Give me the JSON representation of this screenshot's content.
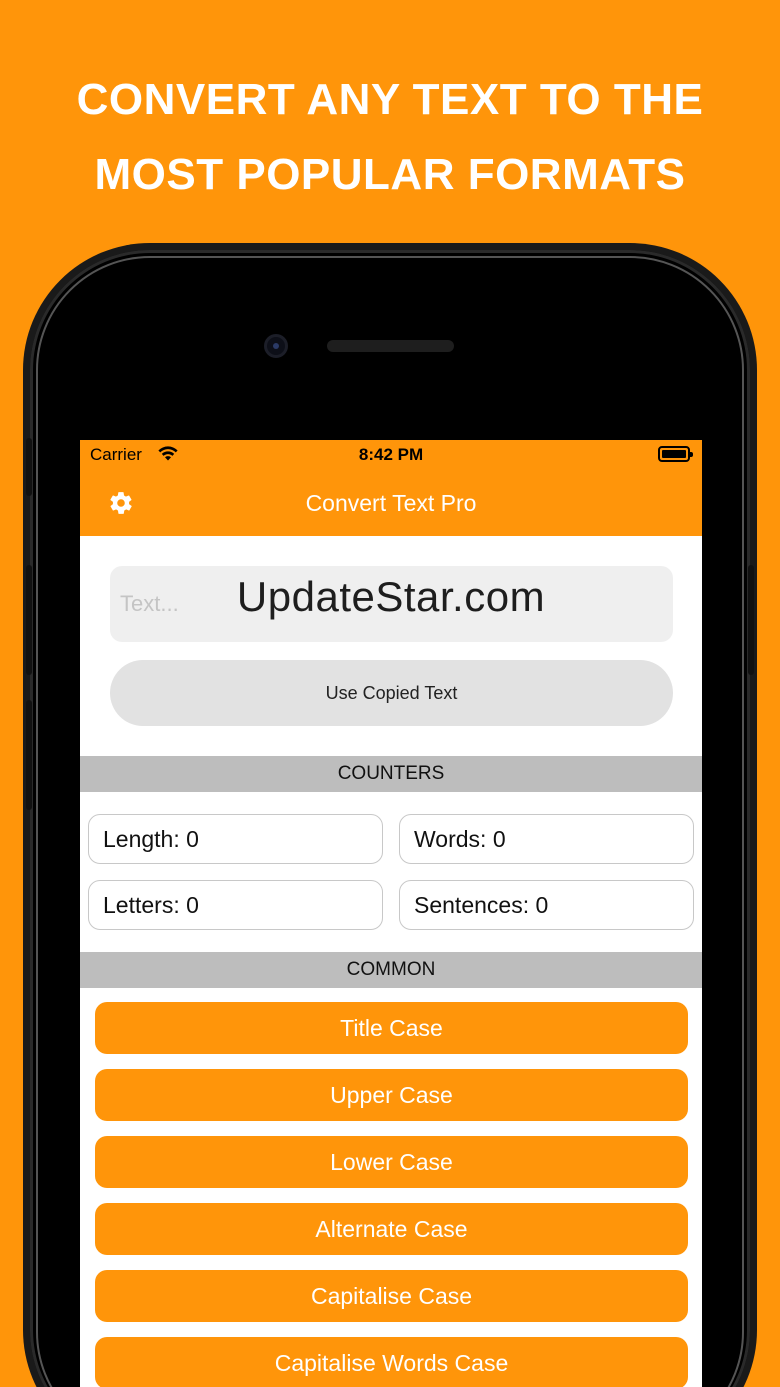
{
  "headline": {
    "line1": "CONVERT ANY TEXT TO THE",
    "line2": "MOST POPULAR FORMATS"
  },
  "status_bar": {
    "carrier": "Carrier",
    "time": "8:42 PM"
  },
  "nav": {
    "title": "Convert Text Pro"
  },
  "input": {
    "placeholder": "Text...",
    "value": "",
    "use_copied_label": "Use Copied Text"
  },
  "watermark": "UpdateStar.com",
  "counters": {
    "header": "COUNTERS",
    "items": [
      {
        "label": "Length:",
        "value": "0"
      },
      {
        "label": "Words:",
        "value": "0"
      },
      {
        "label": "Letters:",
        "value": "0"
      },
      {
        "label": "Sentences:",
        "value": "0"
      }
    ]
  },
  "common": {
    "header": "COMMON",
    "buttons": [
      "Title Case",
      "Upper Case",
      "Lower Case",
      "Alternate Case",
      "Capitalise Case",
      "Capitalise Words Case"
    ]
  },
  "colors": {
    "accent": "#FF950A",
    "section_header_bg": "#BDBDBD",
    "input_bg": "#EFEFEF"
  }
}
